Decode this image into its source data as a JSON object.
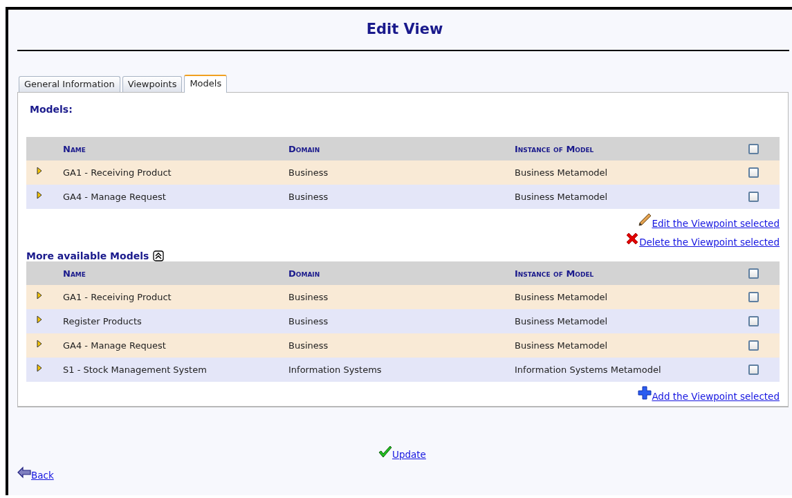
{
  "title": "Edit View",
  "tabs": [
    {
      "label": "General Information",
      "selected": false
    },
    {
      "label": "Viewpoints",
      "selected": false
    },
    {
      "label": "Models",
      "selected": true
    }
  ],
  "models": {
    "heading": "Models:",
    "columns": [
      "Name",
      "Domain",
      "Instance of Model"
    ],
    "header_checked": false,
    "rows": [
      {
        "name": "GA1 - Receiving Product",
        "domain": "Business",
        "instance": "Business Metamodel",
        "checked": false
      },
      {
        "name": "GA4 - Manage Request",
        "domain": "Business",
        "instance": "Business Metamodel",
        "checked": false
      }
    ],
    "actions": [
      {
        "kind": "edit",
        "label": "Edit the Viewpoint selected"
      },
      {
        "kind": "delete",
        "label": "Delete the Viewpoint selected"
      }
    ]
  },
  "available": {
    "heading": "More available Models",
    "collapsed": false,
    "columns": [
      "Name",
      "Domain",
      "Instance of Model"
    ],
    "header_checked": false,
    "rows": [
      {
        "name": "GA1 - Receiving Product",
        "domain": "Business",
        "instance": "Business Metamodel",
        "checked": false
      },
      {
        "name": "Register Products",
        "domain": "Business",
        "instance": "Business Metamodel",
        "checked": false
      },
      {
        "name": "GA4 - Manage Request",
        "domain": "Business",
        "instance": "Business Metamodel",
        "checked": false
      },
      {
        "name": "S1 - Stock Management System",
        "domain": "Information Systems",
        "instance": "Information Systems Metamodel",
        "checked": false
      }
    ],
    "actions": [
      {
        "kind": "add",
        "label": "Add the Viewpoint selected"
      }
    ]
  },
  "update": "Update",
  "back": "Back"
}
